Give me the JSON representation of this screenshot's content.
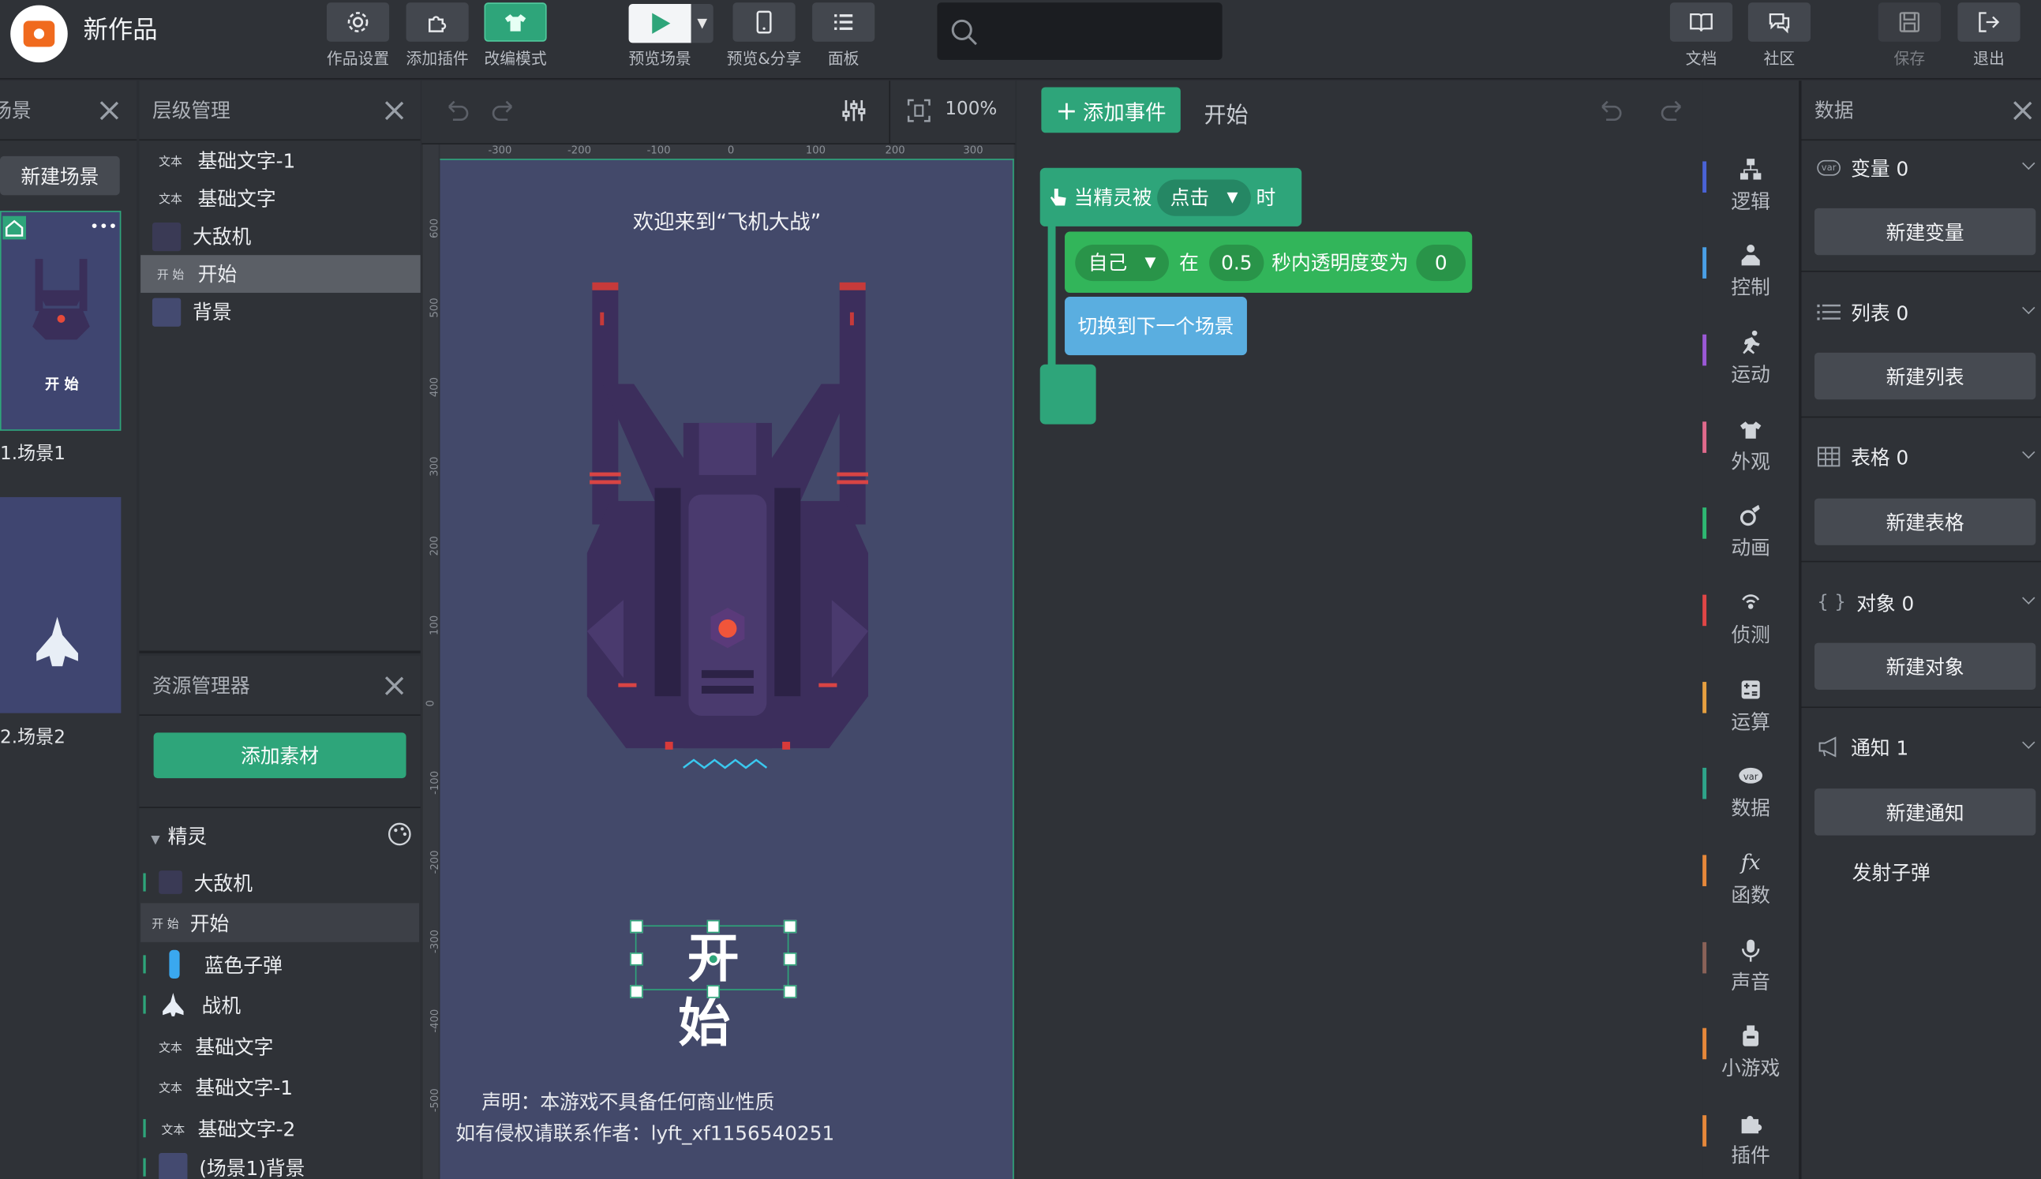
{
  "app": {
    "title": "新作品"
  },
  "toolbar": {
    "settings_label": "作品设置",
    "plugin_label": "添加插件",
    "mode_label": "改编模式",
    "preview_label": "预览场景",
    "share_label": "预览&分享",
    "panel_label": "面板",
    "docs_label": "文档",
    "community_label": "社区",
    "save_label": "保存",
    "exit_label": "退出"
  },
  "scenes": {
    "title": "场景",
    "new_button": "新建场景",
    "items": [
      {
        "label": "1.场景1",
        "thumb_start": "开 始"
      },
      {
        "label": "2.场景2"
      }
    ]
  },
  "layers": {
    "title": "层级管理",
    "items": [
      {
        "tag": "文本",
        "label": "基础文字-1"
      },
      {
        "tag": "文本",
        "label": "基础文字"
      },
      {
        "tag": "",
        "label": "大敌机"
      },
      {
        "tag": "开 始",
        "label": "开始"
      },
      {
        "tag": "",
        "label": "背景"
      }
    ]
  },
  "resources": {
    "title": "资源管理器",
    "add_button": "添加素材",
    "group": "精灵",
    "items": [
      {
        "tag": "",
        "label": "大敌机"
      },
      {
        "tag": "开 始",
        "label": "开始"
      },
      {
        "tag": "",
        "label": "蓝色子弹"
      },
      {
        "tag": "",
        "label": "战机"
      },
      {
        "tag": "文本",
        "label": "基础文字"
      },
      {
        "tag": "文本",
        "label": "基础文字-1"
      },
      {
        "tag": "文本",
        "label": "基础文字-2"
      },
      {
        "tag": "",
        "label": "(场景1)背景"
      }
    ]
  },
  "stage": {
    "zoom": "100%",
    "ruler_x": [
      "-300",
      "-200",
      "-100",
      "0",
      "100",
      "200",
      "300"
    ],
    "ruler_y": [
      "600",
      "500",
      "400",
      "300",
      "200",
      "100",
      "0",
      "-100",
      "-200",
      "-300",
      "-400",
      "-500"
    ],
    "welcome": "欢迎来到“飞机大战”",
    "start_text": "开始",
    "disclaimer_1": "声明：本游戏不具备任何商业性质",
    "disclaimer_2": "如有侵权请联系作者：lyft_xf1156540251"
  },
  "code": {
    "add_event": "添加事件",
    "sprite_name": "开始",
    "event_prefix": "当精灵被",
    "event_option": "点击",
    "event_suffix": "时",
    "target": "自己",
    "in_word": "在",
    "seconds": "0.5",
    "opacity_text": "秒内透明度变为",
    "opacity_value": "0",
    "next_scene": "切换到下一个场景"
  },
  "categories": [
    {
      "label": "逻辑",
      "color": "#4a63d6"
    },
    {
      "label": "控制",
      "color": "#4aa0e6"
    },
    {
      "label": "运动",
      "color": "#9b59d6"
    },
    {
      "label": "外观",
      "color": "#e06a8c"
    },
    {
      "label": "动画",
      "color": "#2eb872"
    },
    {
      "label": "侦测",
      "color": "#e04646"
    },
    {
      "label": "运算",
      "color": "#e6a040"
    },
    {
      "label": "数据",
      "color": "#2ea58a"
    },
    {
      "label": "函数",
      "color": "#e6883a"
    },
    {
      "label": "声音",
      "color": "#8a6258"
    },
    {
      "label": "小游戏",
      "color": "#e6883a"
    },
    {
      "label": "插件",
      "color": "#e6883a"
    }
  ],
  "data_panel": {
    "title": "数据",
    "sections": [
      {
        "label": "变量 0",
        "button": "新建变量"
      },
      {
        "label": "列表 0",
        "button": "新建列表"
      },
      {
        "label": "表格 0",
        "button": "新建表格"
      },
      {
        "label": "对象 0",
        "button": "新建对象"
      },
      {
        "label": "通知 1",
        "button": "新建通知"
      }
    ],
    "notice_item": "发射子弹",
    "var_badge": "var"
  }
}
